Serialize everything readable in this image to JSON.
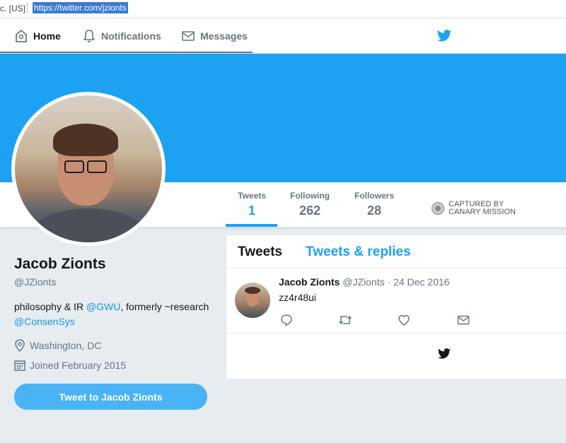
{
  "browser": {
    "security_text": "c. [US]",
    "url": "https://twitter.com/jzionts"
  },
  "nav": {
    "home": "Home",
    "notifications": "Notifications",
    "messages": "Messages"
  },
  "profile": {
    "name": "Jacob Zionts",
    "handle": "@JZionts",
    "bio_part1": "philosophy & IR ",
    "bio_mention1": "@GWU",
    "bio_part2": ", formerly ~research ",
    "bio_mention2": "@ConsenSys",
    "location": "Washington, DC",
    "joined": "Joined February 2015",
    "tweet_to_label": "Tweet to Jacob Zionts"
  },
  "stats": [
    {
      "label": "Tweets",
      "value": "1"
    },
    {
      "label": "Following",
      "value": "262"
    },
    {
      "label": "Followers",
      "value": "28"
    }
  ],
  "canary": {
    "line1": "CAPTURED BY",
    "line2": "CANARY MISSION"
  },
  "timeline": {
    "tabs": [
      "Tweets",
      "Tweets & replies"
    ],
    "tweet": {
      "name": "Jacob Zionts",
      "handle": "@JZionts",
      "separator": "·",
      "date": "24 Dec 2016",
      "text": "zz4r48ui"
    }
  },
  "icons": {
    "home": "home-icon",
    "notifications": "bell-icon",
    "messages": "envelope-icon",
    "brand": "twitter-bird-icon",
    "location": "location-pin-icon",
    "calendar": "calendar-icon",
    "reply": "reply-icon",
    "retweet": "retweet-icon",
    "like": "heart-icon",
    "dm": "direct-message-icon"
  },
  "colors": {
    "brand": "#1da1f2",
    "button": "#4ab3f4",
    "link": "#1b95e0",
    "background": "#e6ecf0"
  }
}
